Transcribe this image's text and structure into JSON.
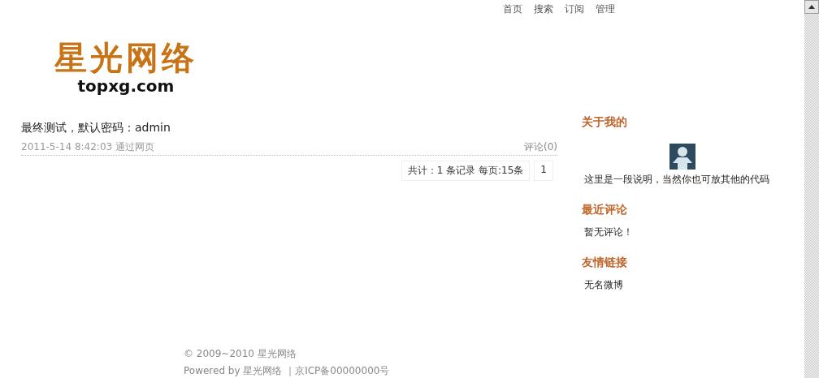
{
  "nav": [
    "首页",
    "搜索",
    "订阅",
    "管理"
  ],
  "logo": {
    "title": "星光网络",
    "domain": "topxg.com"
  },
  "posts": [
    {
      "title": "最终测试，默认密码：admin",
      "meta": "2011-5-14 8:42:03 通过网页",
      "comments": "评论(0)"
    }
  ],
  "pager": {
    "summary": "共计：1 条记录 每页:15条",
    "pages": [
      "1"
    ]
  },
  "sidebar": [
    {
      "kind": "about",
      "heading": "关于我的",
      "text": "这里是一段说明，当然你也可放其他的代码"
    },
    {
      "kind": "list",
      "heading": "最近评论",
      "items": [
        "暂无评论！"
      ]
    },
    {
      "kind": "list",
      "heading": "友情链接",
      "items": [
        "无名微博"
      ]
    }
  ],
  "footer": {
    "copyright": "© 2009~2010 星光网络",
    "powered": "Powered by 星光网络 ｜京ICP备00000000号"
  }
}
